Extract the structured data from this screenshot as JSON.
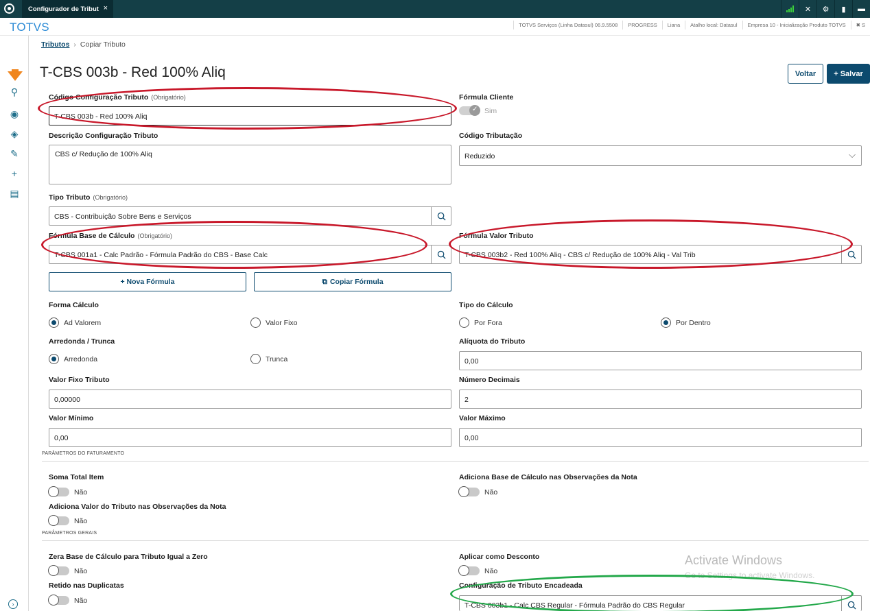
{
  "tab": {
    "title": "Configurador de Tribut",
    "close": "×"
  },
  "brand": "TOTVS",
  "header_infos": [
    "TOTVS Serviços (Linha Datasul) 06.9.5508",
    "PROGRESS",
    "Liana",
    "Atalho local: Datasul",
    "Empresa 10 - Inicialização Produto TOTVS",
    "✖ S"
  ],
  "breadcrumb": {
    "root": "Tributos",
    "current": "Copiar Tributo"
  },
  "page_title": "T-CBS 003b - Red 100% Aliq",
  "actions": {
    "back": "Voltar",
    "save": "Salvar"
  },
  "fields": {
    "codigo": {
      "label": "Código Configuração Tributo",
      "required": "(Obrigatório)",
      "value": "T-CBS 003b - Red 100% Aliq"
    },
    "formula_cliente": {
      "label": "Fórmula Cliente",
      "value": "Sim"
    },
    "descricao": {
      "label": "Descrição Configuração Tributo",
      "value": "CBS c/ Redução de 100% Aliq"
    },
    "codigo_tributacao": {
      "label": "Código Tributação",
      "value": "Reduzido"
    },
    "tipo_tributo": {
      "label": "Tipo Tributo",
      "required": "(Obrigatório)",
      "value": "CBS - Contribuição Sobre Bens e Serviços"
    },
    "formula_base": {
      "label": "Fórmula Base de Cálculo",
      "required": "(Obrigatório)",
      "value": "T-CBS 001a1 - Calc Padrão - Fórmula Padrão do CBS - Base Calc"
    },
    "formula_valor": {
      "label": "Fórmula Valor Tributo",
      "value": "T-CBS 003b2 - Red 100% Aliq - CBS c/ Redução de 100% Aliq - Val Trib"
    },
    "nova_formula": "+ Nova Fórmula",
    "copiar_formula": "Copiar Fórmula",
    "forma_calculo": {
      "label": "Forma Cálculo",
      "opt1": "Ad Valorem",
      "opt2": "Valor Fixo"
    },
    "tipo_calculo": {
      "label": "Tipo do Cálculo",
      "opt1": "Por Fora",
      "opt2": "Por Dentro"
    },
    "arredonda": {
      "label": "Arredonda / Trunca",
      "opt1": "Arredonda",
      "opt2": "Trunca"
    },
    "aliquota": {
      "label": "Alíquota do Tributo",
      "value": "0,00"
    },
    "valor_fixo": {
      "label": "Valor Fixo Tributo",
      "value": "0,00000"
    },
    "num_decimais": {
      "label": "Número Decimais",
      "value": "2"
    },
    "valor_minimo": {
      "label": "Valor Mínimo",
      "value": "0,00"
    },
    "valor_maximo": {
      "label": "Valor Máximo",
      "value": "0,00"
    }
  },
  "sections": {
    "faturamento": "PARÂMETROS DO FATURAMENTO",
    "gerais": "PARÂMETROS GERAIS"
  },
  "toggles": {
    "soma_total": {
      "label": "Soma Total Item",
      "value": "Não"
    },
    "adiciona_base": {
      "label": "Adiciona Base de Cálculo nas Observações da Nota",
      "value": "Não"
    },
    "adiciona_valor": {
      "label": "Adiciona Valor do Tributo nas Observações da Nota",
      "value": "Não"
    },
    "zera_base": {
      "label": "Zera Base de Cálculo para Tributo Igual a Zero",
      "value": "Não"
    },
    "aplicar_desconto": {
      "label": "Aplicar como Desconto",
      "value": "Não"
    },
    "retido": {
      "label": "Retido nas Duplicatas",
      "value": "Não"
    }
  },
  "config_encadeada": {
    "label": "Configuração de Tributo Encadeada",
    "value": "T-CBS 003b1 - Calc CBS Regular - Fórmula Padrão do CBS Regular"
  },
  "watermark": {
    "line1": "Activate Windows",
    "line2": "Go to Settings to activate Windows."
  },
  "colors": {
    "topbar": "#143f47",
    "primary": "#0c4a6e",
    "brand": "#2c8bd6",
    "red_mark": "#c8182a",
    "green_mark": "#23a84a",
    "orange": "#f0861e"
  }
}
